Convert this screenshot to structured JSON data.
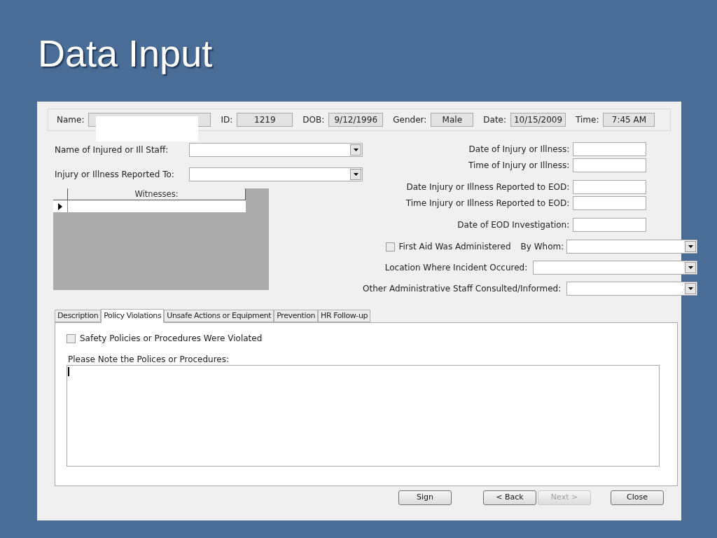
{
  "slide_title": "Data Input",
  "header_fields": [
    {
      "label": "Name:"
    },
    {
      "label": "ID:",
      "value": "1219"
    },
    {
      "label": "DOB:",
      "value": "9/12/1996"
    },
    {
      "label": "Gender:",
      "value": "Male"
    },
    {
      "label": "Date:",
      "value": "10/15/2009"
    },
    {
      "label": "Time:",
      "value": "7:45 AM"
    }
  ],
  "left_fields": [
    {
      "label": "Name of Injured or Ill Staff:"
    },
    {
      "label": "Injury or Illness Reported To:"
    }
  ],
  "witnesses": {
    "column": "Witnesses:"
  },
  "right_groups": [
    [
      {
        "kind": "text",
        "label": "Date of Injury or Illness:"
      },
      {
        "kind": "text",
        "label": "Time of Injury or Illness:"
      }
    ],
    [
      {
        "kind": "text",
        "label": "Date Injury or Illness Reported to EOD:"
      },
      {
        "kind": "text",
        "label": "Time Injury or Illness Reported to EOD:"
      }
    ],
    [
      {
        "kind": "text",
        "label": "Date of EOD Investigation:"
      }
    ],
    [
      {
        "kind": "check_combo",
        "check_label": "First Aid Was Administered",
        "checked": false,
        "label": "By Whom:"
      },
      {
        "kind": "combo",
        "label": "Location Where Incident Occured:"
      },
      {
        "kind": "combo",
        "label": "Other Administrative Staff Consulted/Informed:"
      }
    ]
  ],
  "tabs": [
    {
      "label": "Description",
      "selected": false
    },
    {
      "label": "Policy Violations",
      "selected": true
    },
    {
      "label": "Unsafe Actions or Equipment",
      "selected": false
    },
    {
      "label": "Prevention",
      "selected": false
    },
    {
      "label": "HR Follow-up",
      "selected": false
    }
  ],
  "policy_check": {
    "label": "Safety Policies or Procedures Were Violated",
    "checked": false
  },
  "notes_label": "Please Note the Polices or Procedures:",
  "buttons": [
    {
      "label": "Sign",
      "disabled": false
    },
    {
      "label": "< Back",
      "disabled": false
    },
    {
      "label": "Next >",
      "disabled": true
    },
    {
      "label": "Close",
      "disabled": false
    }
  ]
}
